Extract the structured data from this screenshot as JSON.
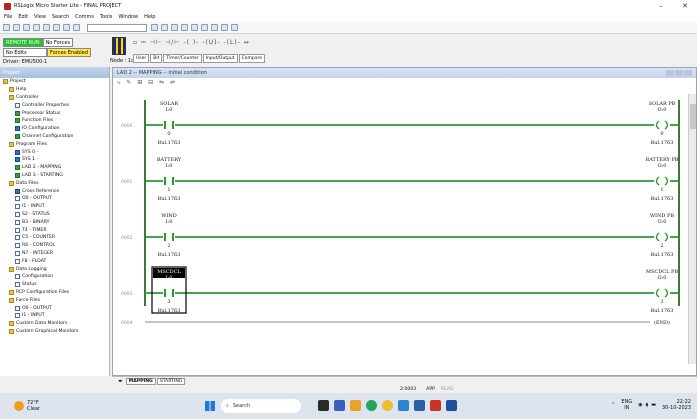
{
  "window": {
    "title": "RSLogix Micro Starter Lite - FINAL PROJECT",
    "minimize": "–",
    "close": "✕"
  },
  "menu": [
    "File",
    "Edit",
    "View",
    "Search",
    "Comms",
    "Tools",
    "Window",
    "Help"
  ],
  "status": {
    "mode": "REMOTE RUN",
    "forces": "No Forces",
    "edits": "No Edits",
    "forces_enabled": "Forces Enabled",
    "driver": "Driver: EMU500-1",
    "node": "Node : 1d"
  },
  "instruction_tabs": [
    "User",
    "Bit",
    "Timer/Counter",
    "Input/Output",
    "Compare"
  ],
  "sidebar": {
    "title": "Project",
    "items": [
      {
        "label": "Project",
        "indent": 0,
        "icon": "folder"
      },
      {
        "label": "Help",
        "indent": 1,
        "icon": "folder"
      },
      {
        "label": "Controller",
        "indent": 1,
        "icon": "folder"
      },
      {
        "label": "Controller Properties",
        "indent": 2,
        "icon": "file"
      },
      {
        "label": "Processor Status",
        "indent": 2,
        "icon": "green"
      },
      {
        "label": "Function Files",
        "indent": 2,
        "icon": "green"
      },
      {
        "label": "IO Configuration",
        "indent": 2,
        "icon": "blue"
      },
      {
        "label": "Channel Configuration",
        "indent": 2,
        "icon": "green"
      },
      {
        "label": "Program Files",
        "indent": 1,
        "icon": "folder"
      },
      {
        "label": "SYS 0 -",
        "indent": 2,
        "icon": "blue"
      },
      {
        "label": "SYS 1 -",
        "indent": 2,
        "icon": "blue"
      },
      {
        "label": "LAD 2 - MAPPING",
        "indent": 2,
        "icon": "green"
      },
      {
        "label": "LAD 3 - STARTING",
        "indent": 2,
        "icon": "green"
      },
      {
        "label": "Data Files",
        "indent": 1,
        "icon": "folder"
      },
      {
        "label": "Cross Reference",
        "indent": 2,
        "icon": "blue"
      },
      {
        "label": "O0 - OUTPUT",
        "indent": 2,
        "icon": "file"
      },
      {
        "label": "I1 - INPUT",
        "indent": 2,
        "icon": "file"
      },
      {
        "label": "S2 - STATUS",
        "indent": 2,
        "icon": "file"
      },
      {
        "label": "B3 - BINARY",
        "indent": 2,
        "icon": "file"
      },
      {
        "label": "T4 - TIMER",
        "indent": 2,
        "icon": "file"
      },
      {
        "label": "C5 - COUNTER",
        "indent": 2,
        "icon": "file"
      },
      {
        "label": "R6 - CONTROL",
        "indent": 2,
        "icon": "file"
      },
      {
        "label": "N7 - INTEGER",
        "indent": 2,
        "icon": "file"
      },
      {
        "label": "F8 - FLOAT",
        "indent": 2,
        "icon": "file"
      },
      {
        "label": "Data Logging",
        "indent": 1,
        "icon": "folder"
      },
      {
        "label": "Configuration",
        "indent": 2,
        "icon": "file"
      },
      {
        "label": "Status",
        "indent": 2,
        "icon": "file"
      },
      {
        "label": "RCP Configuration Files",
        "indent": 1,
        "icon": "folder"
      },
      {
        "label": "Force Files",
        "indent": 1,
        "icon": "folder"
      },
      {
        "label": "O0 - OUTPUT",
        "indent": 2,
        "icon": "file"
      },
      {
        "label": "I1 - INPUT",
        "indent": 2,
        "icon": "file"
      },
      {
        "label": "Custom Data Monitors",
        "indent": 1,
        "icon": "folder"
      },
      {
        "label": "Custom Graphical Monitors",
        "indent": 1,
        "icon": "folder"
      }
    ]
  },
  "ladder": {
    "title": "LAD 2 -- MAPPING -- initial condition",
    "rungs": [
      {
        "num": "0000",
        "contact": {
          "tag": "SOLAR",
          "addr": "I:0",
          "bit": "0",
          "type": "Bul.1763"
        },
        "coil": {
          "tag": "SOLAR PB",
          "addr": "O:0",
          "bit": "0",
          "type": "Bul.1763"
        }
      },
      {
        "num": "0001",
        "contact": {
          "tag": "BATTERY",
          "addr": "I:0",
          "bit": "1",
          "type": "Bul.1763"
        },
        "coil": {
          "tag": "BATTERY PB",
          "addr": "O:0",
          "bit": "1",
          "type": "Bul.1763"
        }
      },
      {
        "num": "0002",
        "contact": {
          "tag": "WIND",
          "addr": "I:0",
          "bit": "2",
          "type": "Bul.1763"
        },
        "coil": {
          "tag": "WIND PB",
          "addr": "O:0",
          "bit": "2",
          "type": "Bul.1763"
        }
      },
      {
        "num": "0003",
        "contact": {
          "tag": "MSCDCL",
          "addr": "I:0",
          "bit": "3",
          "type": "Bul.1763"
        },
        "coil": {
          "tag": "MSCDCL PB",
          "addr": "O:0",
          "bit": "3",
          "type": "Bul.1763"
        }
      }
    ],
    "end_rung": {
      "num": "0004",
      "label": "END"
    }
  },
  "bottom_tabs": [
    "MAPPING",
    "STARTING"
  ],
  "statusbar": {
    "position": "2:0003",
    "mode": "APP",
    "state": "READ"
  },
  "taskbar": {
    "temp": "72°F",
    "weather": "Clear",
    "search": "Search",
    "lang1": "ENG",
    "lang2": "IN",
    "time": "22:22",
    "date": "30-10-2023"
  }
}
